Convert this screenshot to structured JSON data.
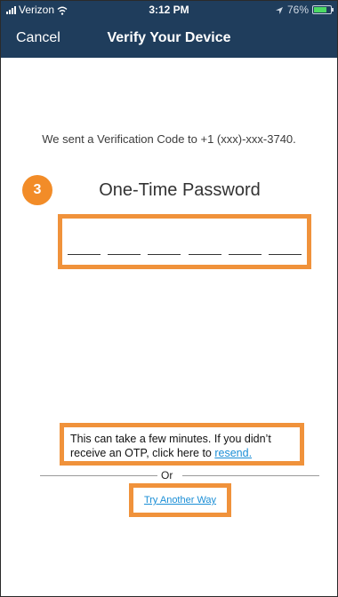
{
  "status_bar": {
    "carrier": "Verizon",
    "time": "3:12 PM",
    "battery_percent": "76%",
    "battery_level": 0.76
  },
  "nav": {
    "cancel_label": "Cancel",
    "title": "Verify Your Device"
  },
  "verification": {
    "sent_message": "We sent a Verification Code to +1 (xxx)-xxx-3740.",
    "step_number": "3",
    "otp_title": "One-Time Password",
    "otp_digits": 6
  },
  "help": {
    "line1": "This can take a few minutes. If you didn’t",
    "line2_prefix": "receive an OTP, click here to ",
    "resend_link": "resend.",
    "or_label": "Or",
    "try_another_way": "Try Another Way"
  },
  "colors": {
    "header_bg": "#1f3d5c",
    "highlight": "#f0923b",
    "link": "#1a8ed6",
    "step_badge": "#f28c28"
  }
}
